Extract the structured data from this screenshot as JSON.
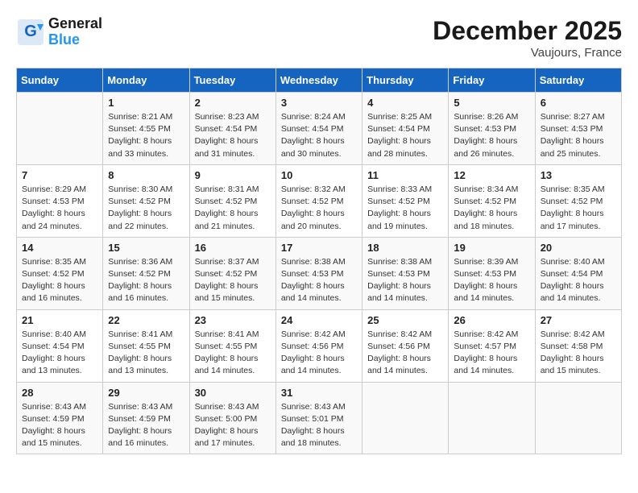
{
  "header": {
    "logo_line1": "General",
    "logo_line2": "Blue",
    "month": "December 2025",
    "location": "Vaujours, France"
  },
  "days_of_week": [
    "Sunday",
    "Monday",
    "Tuesday",
    "Wednesday",
    "Thursday",
    "Friday",
    "Saturday"
  ],
  "weeks": [
    [
      {
        "day": "",
        "info": ""
      },
      {
        "day": "1",
        "info": "Sunrise: 8:21 AM\nSunset: 4:55 PM\nDaylight: 8 hours\nand 33 minutes."
      },
      {
        "day": "2",
        "info": "Sunrise: 8:23 AM\nSunset: 4:54 PM\nDaylight: 8 hours\nand 31 minutes."
      },
      {
        "day": "3",
        "info": "Sunrise: 8:24 AM\nSunset: 4:54 PM\nDaylight: 8 hours\nand 30 minutes."
      },
      {
        "day": "4",
        "info": "Sunrise: 8:25 AM\nSunset: 4:54 PM\nDaylight: 8 hours\nand 28 minutes."
      },
      {
        "day": "5",
        "info": "Sunrise: 8:26 AM\nSunset: 4:53 PM\nDaylight: 8 hours\nand 26 minutes."
      },
      {
        "day": "6",
        "info": "Sunrise: 8:27 AM\nSunset: 4:53 PM\nDaylight: 8 hours\nand 25 minutes."
      }
    ],
    [
      {
        "day": "7",
        "info": "Sunrise: 8:29 AM\nSunset: 4:53 PM\nDaylight: 8 hours\nand 24 minutes."
      },
      {
        "day": "8",
        "info": "Sunrise: 8:30 AM\nSunset: 4:52 PM\nDaylight: 8 hours\nand 22 minutes."
      },
      {
        "day": "9",
        "info": "Sunrise: 8:31 AM\nSunset: 4:52 PM\nDaylight: 8 hours\nand 21 minutes."
      },
      {
        "day": "10",
        "info": "Sunrise: 8:32 AM\nSunset: 4:52 PM\nDaylight: 8 hours\nand 20 minutes."
      },
      {
        "day": "11",
        "info": "Sunrise: 8:33 AM\nSunset: 4:52 PM\nDaylight: 8 hours\nand 19 minutes."
      },
      {
        "day": "12",
        "info": "Sunrise: 8:34 AM\nSunset: 4:52 PM\nDaylight: 8 hours\nand 18 minutes."
      },
      {
        "day": "13",
        "info": "Sunrise: 8:35 AM\nSunset: 4:52 PM\nDaylight: 8 hours\nand 17 minutes."
      }
    ],
    [
      {
        "day": "14",
        "info": "Sunrise: 8:35 AM\nSunset: 4:52 PM\nDaylight: 8 hours\nand 16 minutes."
      },
      {
        "day": "15",
        "info": "Sunrise: 8:36 AM\nSunset: 4:52 PM\nDaylight: 8 hours\nand 16 minutes."
      },
      {
        "day": "16",
        "info": "Sunrise: 8:37 AM\nSunset: 4:52 PM\nDaylight: 8 hours\nand 15 minutes."
      },
      {
        "day": "17",
        "info": "Sunrise: 8:38 AM\nSunset: 4:53 PM\nDaylight: 8 hours\nand 14 minutes."
      },
      {
        "day": "18",
        "info": "Sunrise: 8:38 AM\nSunset: 4:53 PM\nDaylight: 8 hours\nand 14 minutes."
      },
      {
        "day": "19",
        "info": "Sunrise: 8:39 AM\nSunset: 4:53 PM\nDaylight: 8 hours\nand 14 minutes."
      },
      {
        "day": "20",
        "info": "Sunrise: 8:40 AM\nSunset: 4:54 PM\nDaylight: 8 hours\nand 14 minutes."
      }
    ],
    [
      {
        "day": "21",
        "info": "Sunrise: 8:40 AM\nSunset: 4:54 PM\nDaylight: 8 hours\nand 13 minutes."
      },
      {
        "day": "22",
        "info": "Sunrise: 8:41 AM\nSunset: 4:55 PM\nDaylight: 8 hours\nand 13 minutes."
      },
      {
        "day": "23",
        "info": "Sunrise: 8:41 AM\nSunset: 4:55 PM\nDaylight: 8 hours\nand 14 minutes."
      },
      {
        "day": "24",
        "info": "Sunrise: 8:42 AM\nSunset: 4:56 PM\nDaylight: 8 hours\nand 14 minutes."
      },
      {
        "day": "25",
        "info": "Sunrise: 8:42 AM\nSunset: 4:56 PM\nDaylight: 8 hours\nand 14 minutes."
      },
      {
        "day": "26",
        "info": "Sunrise: 8:42 AM\nSunset: 4:57 PM\nDaylight: 8 hours\nand 14 minutes."
      },
      {
        "day": "27",
        "info": "Sunrise: 8:42 AM\nSunset: 4:58 PM\nDaylight: 8 hours\nand 15 minutes."
      }
    ],
    [
      {
        "day": "28",
        "info": "Sunrise: 8:43 AM\nSunset: 4:59 PM\nDaylight: 8 hours\nand 15 minutes."
      },
      {
        "day": "29",
        "info": "Sunrise: 8:43 AM\nSunset: 4:59 PM\nDaylight: 8 hours\nand 16 minutes."
      },
      {
        "day": "30",
        "info": "Sunrise: 8:43 AM\nSunset: 5:00 PM\nDaylight: 8 hours\nand 17 minutes."
      },
      {
        "day": "31",
        "info": "Sunrise: 8:43 AM\nSunset: 5:01 PM\nDaylight: 8 hours\nand 18 minutes."
      },
      {
        "day": "",
        "info": ""
      },
      {
        "day": "",
        "info": ""
      },
      {
        "day": "",
        "info": ""
      }
    ]
  ]
}
